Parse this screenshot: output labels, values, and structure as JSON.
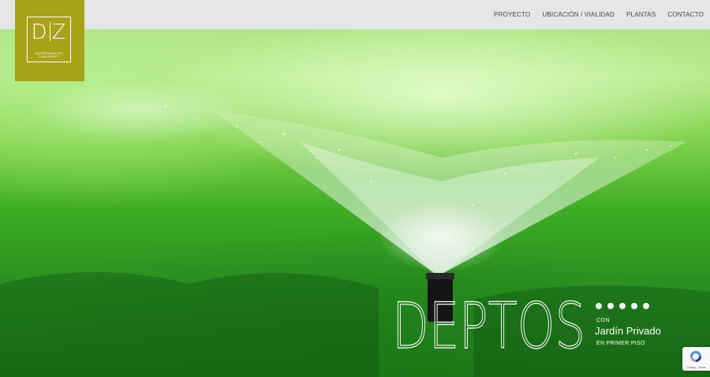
{
  "nav": {
    "items": [
      "PROYECTO",
      "UBICACIÓN / VIALIDAD",
      "PLANTAS",
      "CONTACTO"
    ]
  },
  "logo": {
    "letters_left": "D",
    "letters_right": "Z",
    "subtitle_line1": "DEPARTAMENTOS",
    "subtitle_line2": "ZONA NORTE"
  },
  "hero": {
    "headline": "DEPTOS",
    "with_label": "CON",
    "garden_label": "Jardín Privado",
    "floor_label": "EN PRIMER PISO"
  },
  "slider": {
    "dot_count": 5,
    "active_index": 0
  },
  "recaptcha": {
    "text": "Privacy - Terms"
  },
  "colors": {
    "logo_bg": "#a8a217",
    "topbar_bg": "#e4e6e7",
    "nav_text": "#444444"
  }
}
